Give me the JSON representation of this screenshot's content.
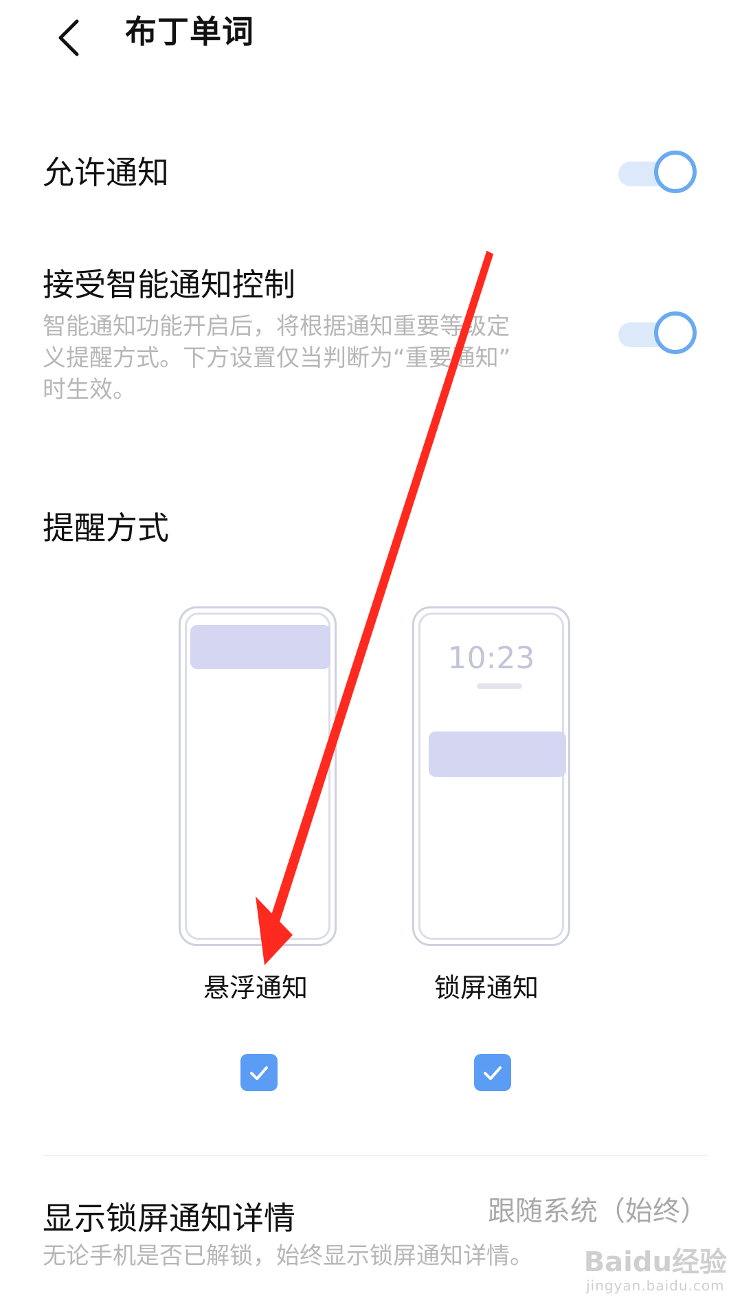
{
  "header": {
    "title": "布丁单词"
  },
  "allow_notification": {
    "title": "允许通知",
    "enabled": true
  },
  "smart_control": {
    "title": "接受智能通知控制",
    "desc_line1": "智能通知功能开启后，将根据通知重要等级定",
    "desc_line2": "义提醒方式。下方设置仅当判断为“重要通知”",
    "desc_line3": "时生效。",
    "enabled": true
  },
  "reminder": {
    "section_title": "提醒方式",
    "floating": {
      "label": "悬浮通知",
      "checked": true
    },
    "lockscreen": {
      "label": "锁屏通知",
      "checked": true,
      "preview_time": "10:23"
    }
  },
  "lock_details": {
    "title": "显示锁屏通知详情",
    "value": "跟随系统（始终）",
    "desc": "无论手机是否已解锁，始终显示锁屏通知详情。"
  },
  "watermark": {
    "brand": "Baidu经验",
    "url": "jingyan.baidu.com"
  },
  "colors": {
    "accent": "#5b9df5",
    "toggle_knob_border": "#6aaaf0",
    "annotation_arrow": "#ff2a1f"
  },
  "icons": {
    "back": "chevron-left-icon",
    "check": "checkmark-icon"
  }
}
